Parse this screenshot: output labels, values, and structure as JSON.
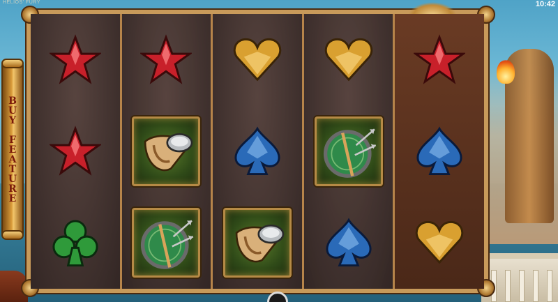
{
  "header": {
    "game_title": "HELIOS' FURY",
    "clock": "10:42"
  },
  "buy_feature": {
    "label": "BUY FEATURE"
  },
  "grid": {
    "reels": [
      [
        "star",
        "star",
        "club"
      ],
      [
        "star",
        "horn",
        "shield"
      ],
      [
        "heart",
        "spade",
        "horn"
      ],
      [
        "heart",
        "shield",
        "spade"
      ],
      [
        "star",
        "spade",
        "heart"
      ]
    ]
  },
  "colors": {
    "star": "#c8202a",
    "heart": "#d9a030",
    "spade": "#2a6ab8",
    "club": "#2f9a3a",
    "frame": "#c89a5a"
  },
  "icons": {
    "star": "red-star-icon",
    "heart": "gold-heart-icon",
    "spade": "blue-spade-icon",
    "club": "green-club-icon",
    "horn": "drinking-horn-icon",
    "shield": "shield-arrow-icon"
  }
}
